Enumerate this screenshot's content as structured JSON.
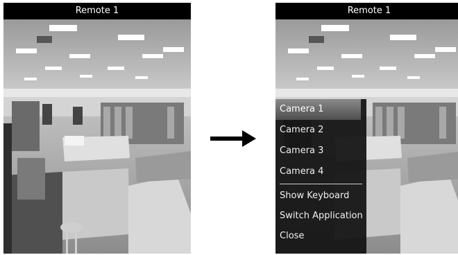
{
  "screens": [
    {
      "title": "Remote 1"
    },
    {
      "title": "Remote 1"
    }
  ],
  "menu": {
    "camera_items": [
      "Camera 1",
      "Camera 2",
      "Camera 3",
      "Camera 4"
    ],
    "selected": "Camera 1",
    "action_items": [
      "Show Keyboard",
      "Switch Application",
      "Close"
    ]
  },
  "arrow": {
    "direction": "right",
    "icon": "arrow-right-icon"
  }
}
